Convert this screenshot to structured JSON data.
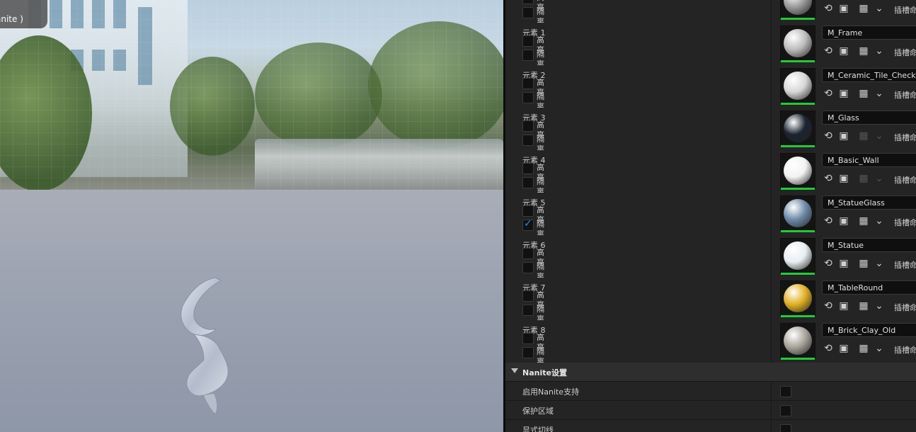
{
  "viewport": {
    "tab_label": "anite )"
  },
  "material_slots": {
    "highlight_label": "高亮",
    "isolate_label": "隔离",
    "slot_name_label": "插槽命",
    "elements": [
      {
        "label": "",
        "material": "",
        "highlight": false,
        "isolate": false,
        "ball_color": "#9a9a9a"
      },
      {
        "label": "元素 1",
        "material": "M_Frame",
        "highlight": false,
        "isolate": false,
        "ball_color": "#bdbdbd"
      },
      {
        "label": "元素 2",
        "material": "M_Ceramic_Tile_Checker",
        "highlight": false,
        "isolate": false,
        "ball_color": "#d6d6d6"
      },
      {
        "label": "元素 3",
        "material": "M_Glass",
        "highlight": false,
        "isolate": false,
        "ball_color": "#1a2330"
      },
      {
        "label": "元素 4",
        "material": "M_Basic_Wall",
        "highlight": false,
        "isolate": false,
        "ball_color": "#f2f2f2"
      },
      {
        "label": "元素 5",
        "material": "M_StatueGlass",
        "highlight": false,
        "isolate": true,
        "ball_color": "#6f8aa8"
      },
      {
        "label": "元素 6",
        "material": "M_Statue",
        "highlight": false,
        "isolate": false,
        "ball_color": "#e8eef2"
      },
      {
        "label": "元素 7",
        "material": "M_TableRound",
        "highlight": false,
        "isolate": false,
        "ball_color": "#e0b020"
      },
      {
        "label": "元素 8",
        "material": "M_Brick_Clay_Old",
        "highlight": false,
        "isolate": false,
        "ball_color": "#a9a59c"
      }
    ]
  },
  "nanite_section": {
    "title": "Nanite设置",
    "properties": [
      {
        "label": "启用Nanite支持",
        "checked": false
      },
      {
        "label": "保护区域",
        "checked": false
      },
      {
        "label": "显式切线",
        "checked": false
      }
    ]
  }
}
